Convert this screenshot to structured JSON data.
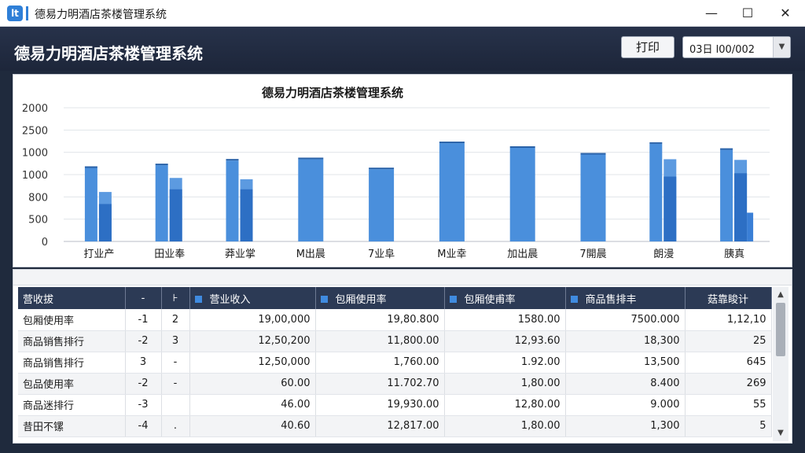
{
  "window": {
    "title": "德易力明酒店茶楼管理系统",
    "icon_text": "lt",
    "minimize": "—",
    "maximize": "☐",
    "close": "✕"
  },
  "header": {
    "title": "德易力明酒店茶楼管理系统",
    "print_label": "打印",
    "date_value": "03日 l00/002",
    "dropdown_arrow": "▼"
  },
  "chart_data": {
    "type": "bar",
    "title": "德易力明酒店茶楼管理系统",
    "y_tick_labels": [
      "2000",
      "2500",
      "1000",
      "1000",
      "800",
      "500",
      "0"
    ],
    "categories": [
      "打业产",
      "田业奉",
      "莽业掌",
      "M出晨",
      "7业阜",
      "M业幸",
      "加出晨",
      "7開晨",
      "朗漫",
      "胰真"
    ],
    "series": [
      {
        "values": [
          1100,
          1140,
          1210,
          1230,
          1080,
          1470,
          1400,
          1300,
          1460,
          1370
        ]
      },
      {
        "values": [
          740,
          950,
          930,
          0,
          0,
          0,
          0,
          0,
          1230,
          1220
        ]
      },
      {
        "values": [
          560,
          780,
          780,
          0,
          0,
          0,
          0,
          0,
          970,
          1020
        ]
      },
      {
        "values": [
          0,
          0,
          0,
          0,
          0,
          0,
          0,
          0,
          0,
          430
        ]
      }
    ],
    "ylim": [
      0,
      2000
    ],
    "grid": true,
    "colors": [
      "#4a8fdc",
      "#5c9ae0",
      "#2d6fc4",
      "#3a7fd6"
    ]
  },
  "table": {
    "headers": [
      "营收拔",
      "-",
      "⊦",
      "营业收入",
      "包厢使用率",
      "包厢使甫率",
      "商品售排丰",
      "菇靠睃计"
    ],
    "header_icons": [
      false,
      false,
      false,
      true,
      true,
      true,
      true,
      false
    ],
    "rows": [
      [
        "包厢使用率",
        "-1",
        "2",
        "19,00,000",
        "19,80.800",
        "1580.00",
        "7500.000",
        "1,12,10"
      ],
      [
        "商品销售排行",
        "-2",
        "3",
        "12,50,200",
        "11,800.00",
        "12,93.60",
        "18,300",
        "25"
      ],
      [
        "商品销售排行",
        "3",
        "-",
        "12,50,000",
        "1,760.00",
        "1.92.00",
        "13,500",
        "645"
      ],
      [
        "包品使用率",
        "-2",
        "-",
        "60.00",
        "11.702.70",
        "1,80.00",
        "8.400",
        "269"
      ],
      [
        "商品迷排行",
        "-3",
        "",
        "46.00",
        "19,930.00",
        "12,80.00",
        "9.000",
        "55"
      ],
      [
        "昔田不镙",
        "-4",
        ".",
        "40.60",
        "12,817.00",
        "1,80.00",
        "1,300",
        "5"
      ]
    ]
  },
  "scroll": {
    "up": "▲",
    "down": "▼"
  },
  "colors": {
    "header_bg": "#27324a",
    "bar_primary": "#4a8fdc",
    "bar_dark": "#2d6fc4",
    "table_header": "#2c3a55"
  }
}
